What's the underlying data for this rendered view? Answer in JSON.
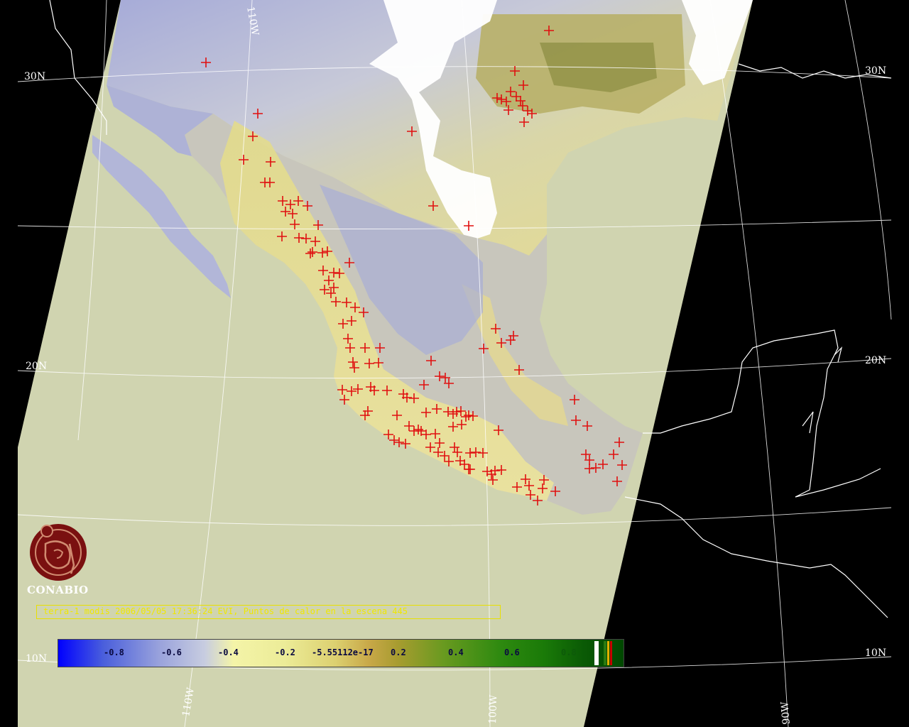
{
  "caption": "terra-1 modis 2006/05/05 17:36:24 EVI, Puntos de calor en la escena 445",
  "logo": {
    "name": "CONABIO",
    "text": "CONABIO"
  },
  "grid_labels": {
    "lat_30n_left": "30N",
    "lat_30n_right": "30N",
    "lat_20n_left": "20N",
    "lat_20n_right": "20N",
    "lat_10n_left": "10N",
    "lat_10n_right": "10N",
    "lon_110w_top": "110W",
    "lon_110w_bottom": "110W",
    "lon_100w_bottom": "100W",
    "lon_90w_bottom": "90W"
  },
  "colorbar": {
    "labels": [
      "-0.8",
      "-0.6",
      "-0.4",
      "-0.2",
      "-5.55112e-17",
      "0.2",
      "0.4",
      "0.6",
      "0.8"
    ],
    "swatch_colors": [
      "#ffffff",
      "#2a7a10",
      "#e0b000",
      "#c80000"
    ]
  },
  "colors": {
    "hotspot": "#e01010",
    "swath_background": "#d0d4b0",
    "cloud": "#ffffff",
    "coastline": "#ffffff",
    "caption_text": "#f0e800",
    "logo": "#7a1010"
  },
  "legend_item": "Puntos de calor",
  "hotspot_count": 445
}
